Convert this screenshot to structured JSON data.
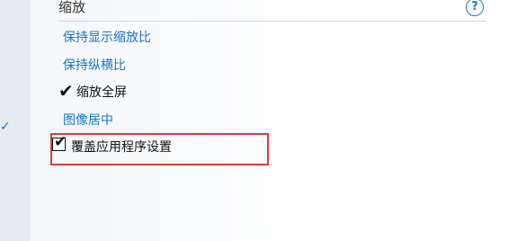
{
  "left_panel": {
    "check_mark": "✓"
  },
  "section": {
    "title": "缩放",
    "help_icon": "help-question-icon",
    "help_symbol": "?"
  },
  "options": {
    "keep_display_ratio": "保持显示缩放比",
    "keep_aspect_ratio": "保持纵横比",
    "scale_fullscreen": "缩放全屏",
    "scale_fullscreen_checked": true,
    "center_image": "图像居中",
    "override_app_settings": "覆盖应用程序设置",
    "override_app_settings_checked": true
  },
  "colors": {
    "link": "#1a73c6",
    "highlight_border": "#e03a3a"
  }
}
